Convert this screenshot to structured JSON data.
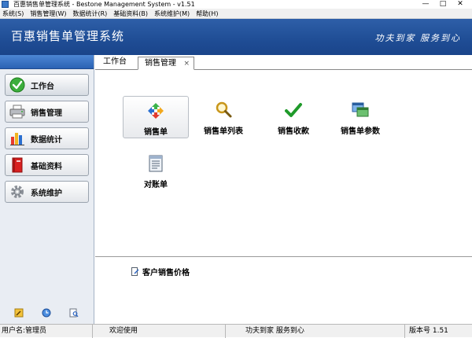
{
  "window": {
    "title": "百惠销售单管理系统 - Bestone Management System - v1.51",
    "controls": {
      "minimize": "—",
      "maximize": "□",
      "close": "✕"
    }
  },
  "menubar": {
    "items": [
      "系统(S)",
      "销售管理(W)",
      "数据统计(R)",
      "基础资料(B)",
      "系统维护(M)",
      "帮助(H)"
    ]
  },
  "banner": {
    "title": "百惠销售单管理系统",
    "slogan": "功夫到家 服务到心"
  },
  "sidebar": {
    "items": [
      {
        "label": "工作台",
        "icon": "check-icon"
      },
      {
        "label": "销售管理",
        "icon": "printer-icon"
      },
      {
        "label": "数据统计",
        "icon": "bar-chart-icon"
      },
      {
        "label": "基础资料",
        "icon": "book-icon"
      },
      {
        "label": "系统维护",
        "icon": "gear-icon"
      }
    ],
    "tools": [
      "edit-icon",
      "clock-icon",
      "search-doc-icon"
    ]
  },
  "tabs": {
    "workbench": "工作台",
    "sales": "销售管理",
    "close": "×"
  },
  "modules": [
    {
      "label": "销售单",
      "icon": "recycle-arrows-icon"
    },
    {
      "label": "销售单列表",
      "icon": "magnifier-icon"
    },
    {
      "label": "销售收款",
      "icon": "check-icon"
    },
    {
      "label": "销售单参数",
      "icon": "windows-icon"
    },
    {
      "label": "对账单",
      "icon": "ledger-icon"
    }
  ],
  "lower_panel": {
    "item_label": "客户销售价格"
  },
  "statusbar": {
    "user": "用户名:管理员",
    "welcome": "欢迎使用",
    "slogan": "功夫到家 服务到心",
    "version": "版本号 1.51"
  },
  "colors": {
    "banner": "#1f4d95",
    "sidebar_bg": "#e9edf3",
    "accent_green": "#2aa82a"
  }
}
